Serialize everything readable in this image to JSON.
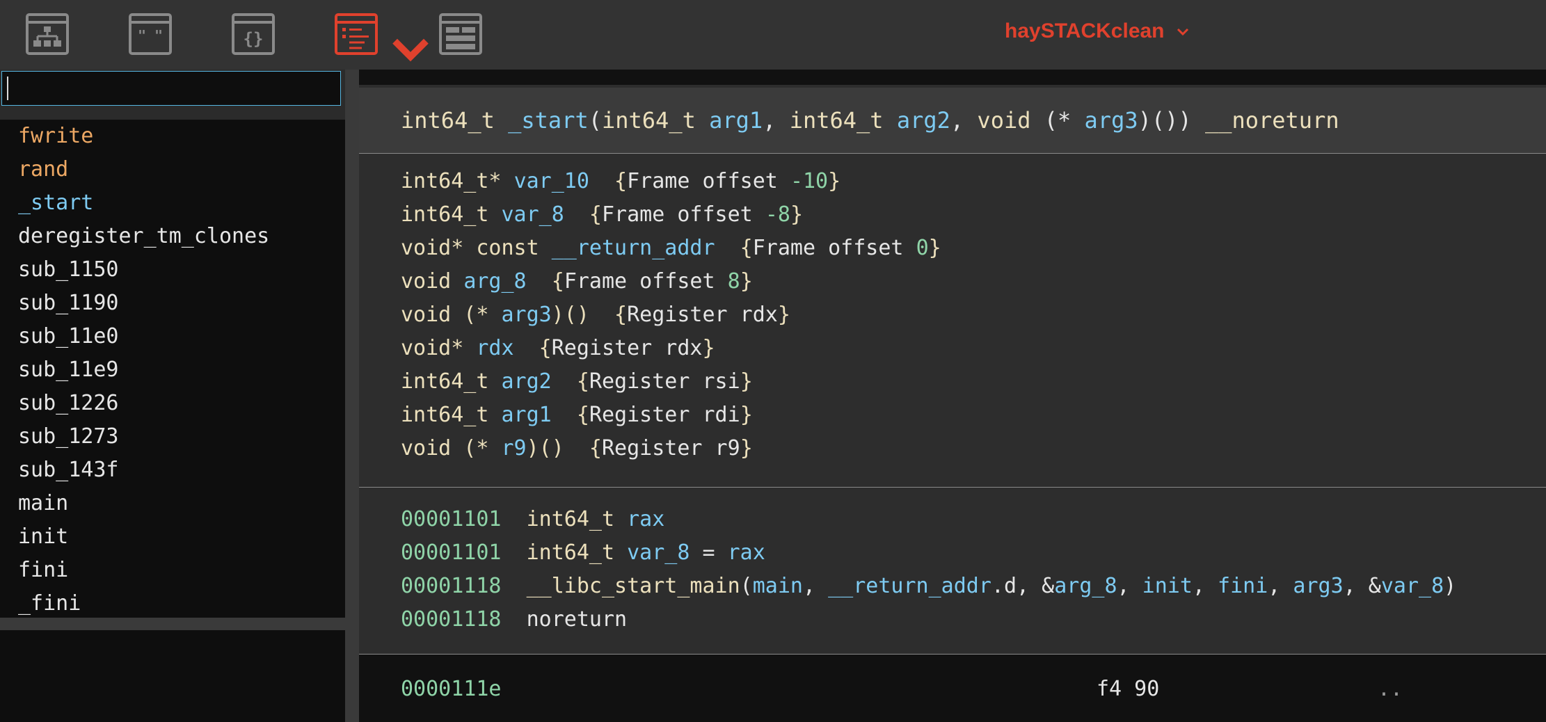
{
  "colors": {
    "accent": "#e0412d",
    "toolbar_bg": "#333333",
    "list_bg": "#0e0e0e",
    "import_func": "#eda864",
    "selected_func": "#7ecbf2",
    "type": "#ece0bc",
    "variable": "#7ecbf2",
    "number": "#8fd4a8"
  },
  "toolbar": {
    "icons": [
      "graph-view-icon",
      "strings-view-icon",
      "types-view-icon",
      "linear-view-icon",
      "hex-view-icon"
    ],
    "active_view": "linear-view-icon",
    "project_name": "haySTACKclean"
  },
  "search": {
    "value": "",
    "placeholder": ""
  },
  "functions": [
    {
      "name": "fwrite",
      "kind": "import"
    },
    {
      "name": "rand",
      "kind": "import"
    },
    {
      "name": "_start",
      "kind": "selected"
    },
    {
      "name": "deregister_tm_clones",
      "kind": "normal"
    },
    {
      "name": "sub_1150",
      "kind": "normal"
    },
    {
      "name": "sub_1190",
      "kind": "normal"
    },
    {
      "name": "sub_11e0",
      "kind": "normal"
    },
    {
      "name": "sub_11e9",
      "kind": "normal"
    },
    {
      "name": "sub_1226",
      "kind": "normal"
    },
    {
      "name": "sub_1273",
      "kind": "normal"
    },
    {
      "name": "sub_143f",
      "kind": "normal"
    },
    {
      "name": "main",
      "kind": "normal"
    },
    {
      "name": "init",
      "kind": "normal"
    },
    {
      "name": "fini",
      "kind": "normal"
    },
    {
      "name": "_fini",
      "kind": "normal"
    }
  ],
  "signature": {
    "ret_type": "int64_t",
    "name": "_start",
    "p1_type": "int64_t",
    "p1_name": "arg1",
    "p2_type": "int64_t",
    "p2_name": "arg2",
    "p3_type": "void",
    "p3_name": "arg3",
    "attr": "__noreturn"
  },
  "variables": [
    {
      "type": "int64_t*",
      "name": "var_10",
      "loc": "Frame offset",
      "val": "-10"
    },
    {
      "type": "int64_t",
      "name": "var_8",
      "loc": "Frame offset",
      "val": "-8"
    },
    {
      "type": "void* const",
      "name": "__return_addr",
      "loc": "Frame offset",
      "val": "0"
    },
    {
      "type": "void",
      "name": "arg_8",
      "loc": "Frame offset",
      "val": "8"
    },
    {
      "type": "void (*",
      "name": "arg3",
      "suffix": ")()",
      "loc": "Register rdx",
      "val": ""
    },
    {
      "type": "void*",
      "name": "rdx",
      "loc": "Register rdx",
      "val": ""
    },
    {
      "type": "int64_t",
      "name": "arg2",
      "loc": "Register rsi",
      "val": ""
    },
    {
      "type": "int64_t",
      "name": "arg1",
      "loc": "Register rdi",
      "val": ""
    },
    {
      "type": "void (*",
      "name": "r9",
      "suffix": ")()",
      "loc": "Register r9",
      "val": ""
    }
  ],
  "code": {
    "l1_addr": "00001101",
    "l1_type": "int64_t",
    "l1_var": "rax",
    "l2_addr": "00001101",
    "l2_type": "int64_t",
    "l2_var": "var_8",
    "l2_op": "=",
    "l2_rhs": "rax",
    "l3_addr": "00001118",
    "l3_func": "__libc_start_main",
    "l3_a1": "main",
    "l3_a2": "__return_addr",
    "l3_a2_suffix": ".d",
    "l3_a3": "arg_8",
    "l3_a4": "init",
    "l3_a5": "fini",
    "l3_a6": "arg3",
    "l3_a7": "var_8",
    "l4_addr": "00001118",
    "l4_text": "noreturn"
  },
  "hex": {
    "addr": "0000111e",
    "bytes": "f4 90",
    "ascii": ".."
  }
}
